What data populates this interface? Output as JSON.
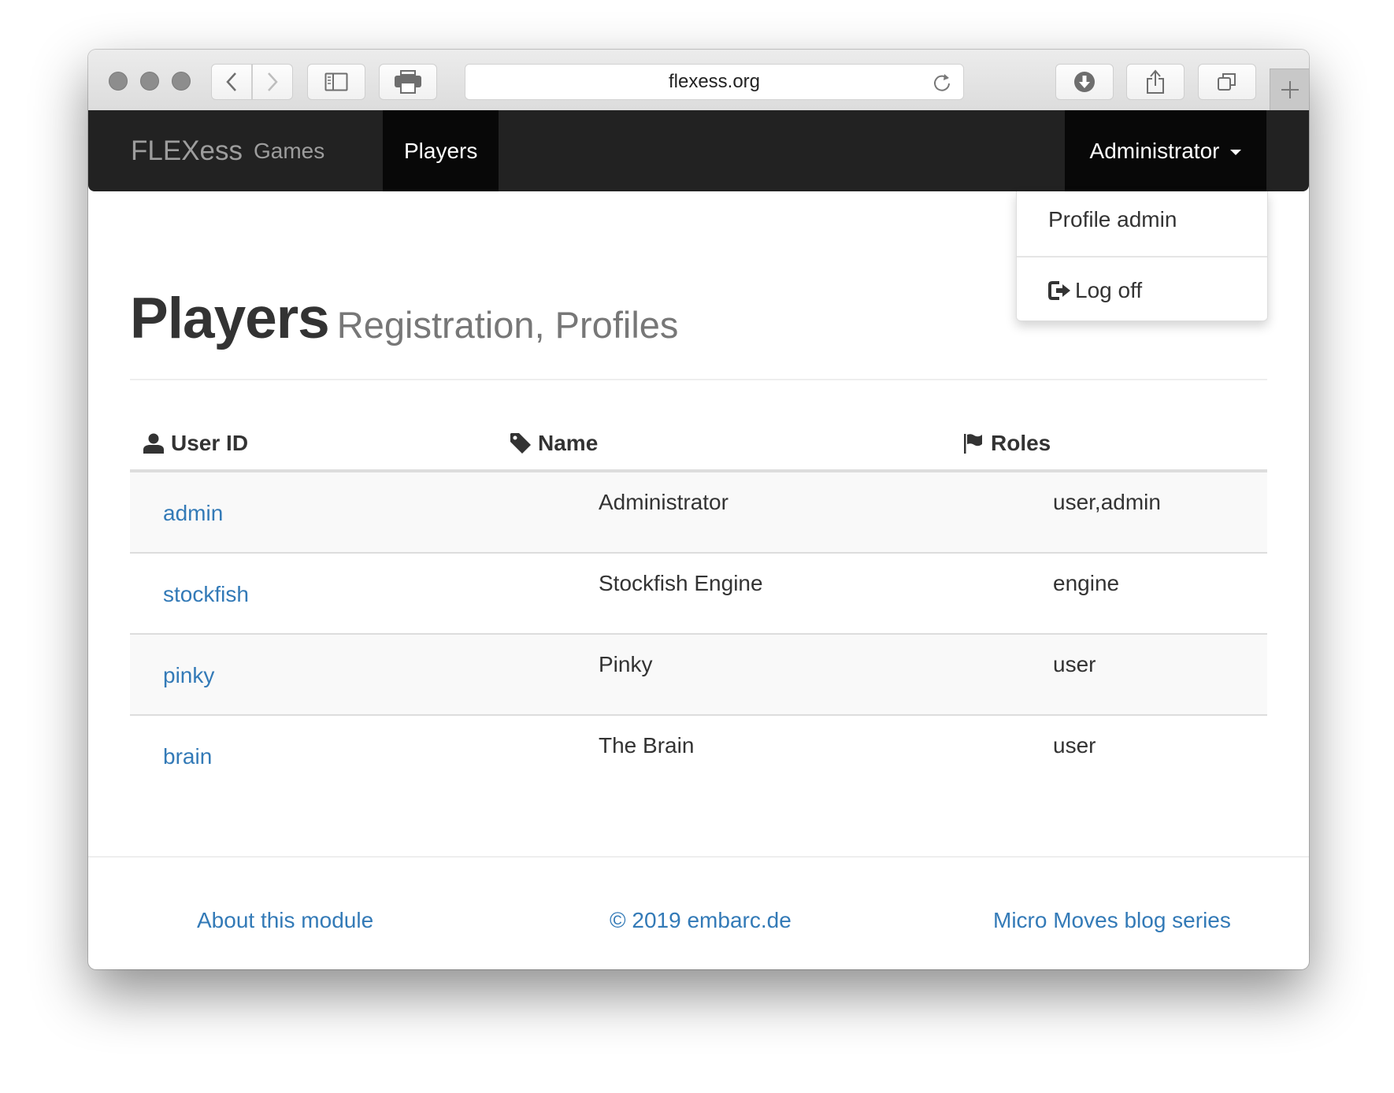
{
  "browser": {
    "url": "flexess.org",
    "icons": [
      "back-icon",
      "forward-icon",
      "sidebar-icon",
      "print-icon",
      "reload-icon",
      "download-icon",
      "share-icon",
      "tabs-icon",
      "new-tab-icon"
    ]
  },
  "navbar": {
    "brand": "FLEXess",
    "links": [
      {
        "label": "Games",
        "active": false
      },
      {
        "label": "Players",
        "active": true
      }
    ],
    "user_menu_label": "Administrator"
  },
  "dropdown": {
    "items": [
      {
        "label": "Profile admin"
      },
      {
        "label": "Log off",
        "icon": "log-off-icon"
      }
    ]
  },
  "page": {
    "title": "Players",
    "subtitle": "Registration, Profiles"
  },
  "table": {
    "columns": [
      {
        "label": "User ID",
        "icon": "user-icon"
      },
      {
        "label": "Name",
        "icon": "tag-icon"
      },
      {
        "label": "Roles",
        "icon": "flag-icon"
      }
    ],
    "rows": [
      {
        "user_id": "admin",
        "name": "Administrator",
        "roles": "user,admin"
      },
      {
        "user_id": "stockfish",
        "name": "Stockfish Engine",
        "roles": "engine"
      },
      {
        "user_id": "pinky",
        "name": "Pinky",
        "roles": "user"
      },
      {
        "user_id": "brain",
        "name": "The Brain",
        "roles": "user"
      }
    ]
  },
  "footer": {
    "links": [
      {
        "label": "About this module"
      },
      {
        "label": "© 2019 embarc.de"
      },
      {
        "label": "Micro Moves blog series"
      }
    ]
  },
  "colors": {
    "navbar_bg": "#222222",
    "navbar_active_bg": "#080808",
    "link": "#337ab7",
    "text": "#333333",
    "muted": "#777777",
    "stripe": "#f9f9f9"
  }
}
